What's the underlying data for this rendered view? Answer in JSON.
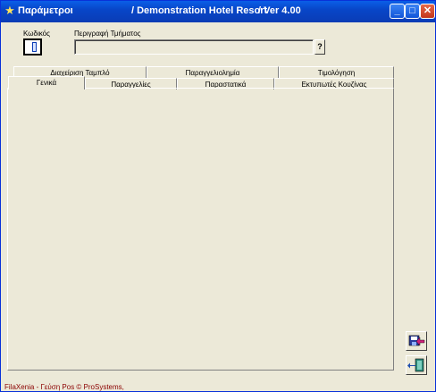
{
  "window": {
    "title": "Παράμετροι",
    "subtitle": "/ Demonstration Hotel Resort",
    "version": "/  Ver  4.00",
    "minimize_glyph": "_",
    "maximize_glyph": "□",
    "close_glyph": "✕"
  },
  "form": {
    "code_label": "Κωδικός",
    "code_value": "",
    "description_label": "Περιγραφή Τμήματος",
    "description_value": "",
    "help_label": "?"
  },
  "tabs": {
    "row1": [
      "Διαχείριση Ταμπλό",
      "Παραγγελιολημία",
      "Τιμολόγηση"
    ],
    "row2": [
      "Γενικά",
      "Παραγγελίες",
      "Παραστατικά",
      "Εκτυπωτές Κουζίνας"
    ],
    "active": "Γενικά"
  },
  "footer": {
    "text": "FilaXenia - Γεύση Pos © ProSystems,"
  },
  "colors": {
    "title_bar": "#0846c8",
    "window_bg": "#ece9d8",
    "footer_text": "#8b0000"
  },
  "icons": {
    "app": "star-icon",
    "save_exit": "save-exit-icon",
    "exit": "exit-door-icon"
  }
}
